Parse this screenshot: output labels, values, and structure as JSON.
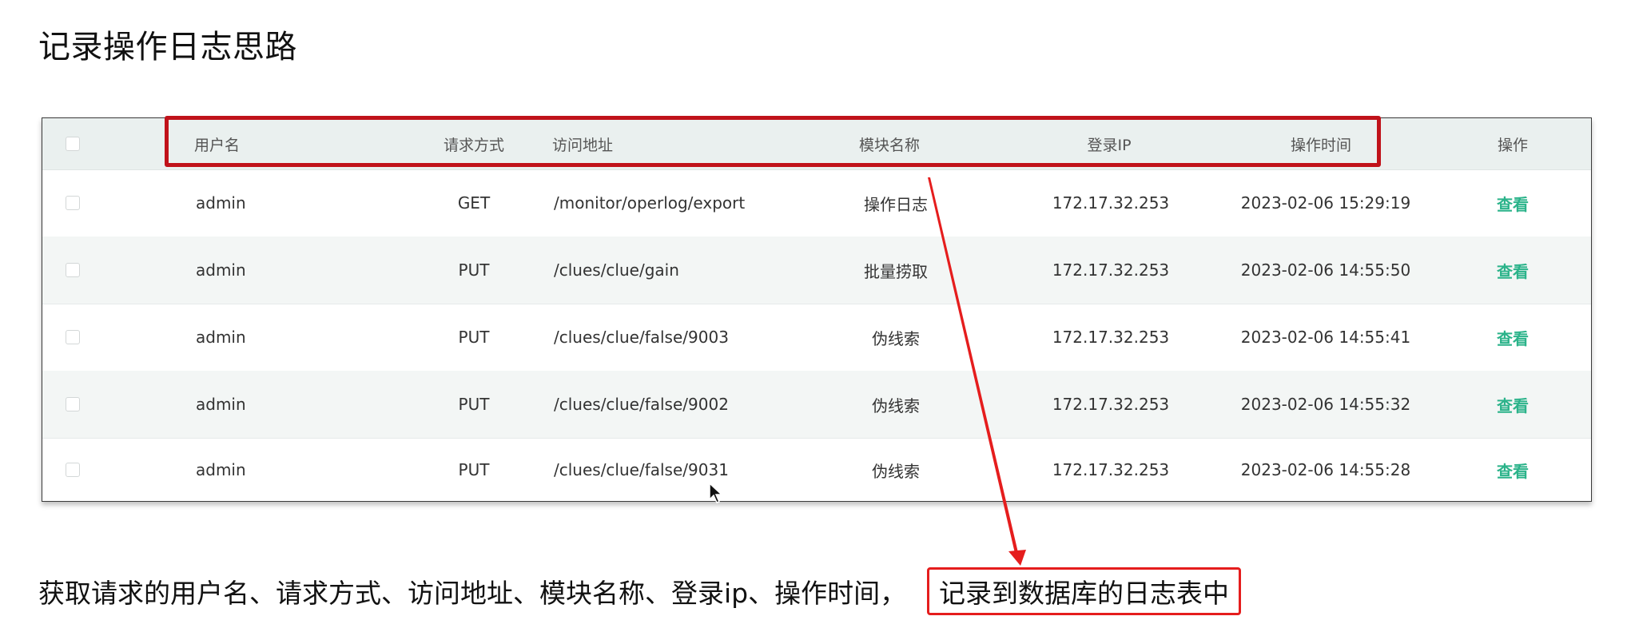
{
  "title": "记录操作日志思路",
  "table": {
    "headers": [
      "用户名",
      "请求方式",
      "访问地址",
      "模块名称",
      "登录IP",
      "操作时间",
      "操作"
    ],
    "rows": [
      [
        "admin",
        "GET",
        "/monitor/operlog/export",
        "操作日志",
        "172.17.32.253",
        "2023-02-06 15:29:19",
        "查看"
      ],
      [
        "admin",
        "PUT",
        "/clues/clue/gain",
        "批量捞取",
        "172.17.32.253",
        "2023-02-06 14:55:50",
        "查看"
      ],
      [
        "admin",
        "PUT",
        "/clues/clue/false/9003",
        "伪线索",
        "172.17.32.253",
        "2023-02-06 14:55:41",
        "查看"
      ],
      [
        "admin",
        "PUT",
        "/clues/clue/false/9002",
        "伪线索",
        "172.17.32.253",
        "2023-02-06 14:55:32",
        "查看"
      ],
      [
        "admin",
        "PUT",
        "/clues/clue/false/9031",
        "伪线索",
        "172.17.32.253",
        "2023-02-06 14:55:28",
        "查看"
      ]
    ]
  },
  "caption": {
    "text": "获取请求的用户名、请求方式、访问地址、模块名称、登录ip、操作时间，",
    "highlight": "记录到数据库的日志表中"
  },
  "colors": {
    "accent_link": "#2bb38a",
    "annotation_red": "#e51d1d",
    "header_box_red": "#c0121a"
  }
}
